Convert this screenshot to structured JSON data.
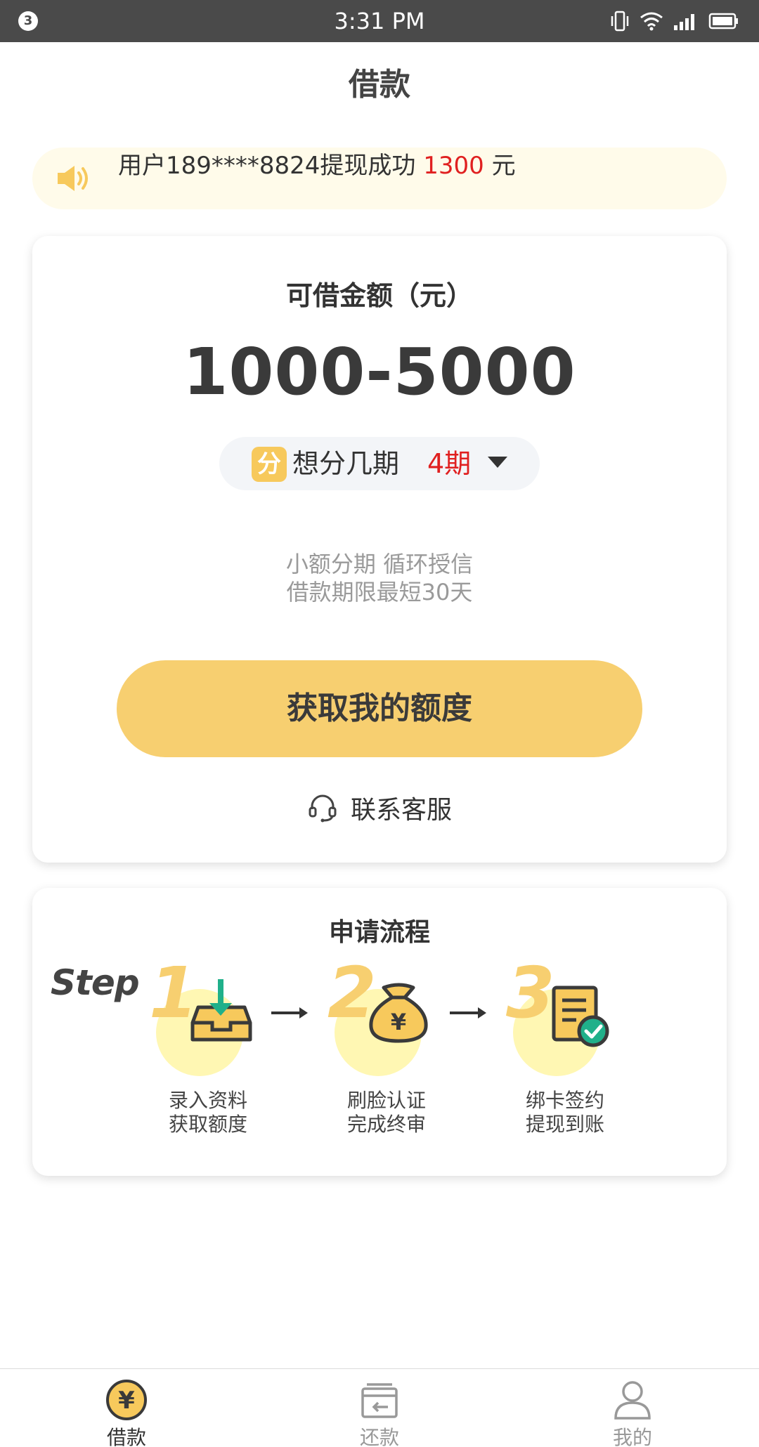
{
  "status_bar": {
    "notification_count": "3",
    "time": "3:31 PM"
  },
  "header": {
    "title": "借款"
  },
  "notice": {
    "prefix": "用户189****8824提现成功 ",
    "amount": "1300",
    "suffix": " 元"
  },
  "loan_card": {
    "label": "可借金额（元）",
    "amount_range": "1000-5000",
    "installment_badge": "分",
    "installment_prompt": "想分几期",
    "installment_value": "4期",
    "desc_line1": "小额分期 循环授信",
    "desc_line2": "借款期限最短30天",
    "cta_label": "获取我的额度",
    "support_label": "联系客服"
  },
  "process": {
    "title": "申请流程",
    "step_word": "Step",
    "steps": [
      {
        "num": "1",
        "line1": "录入资料",
        "line2": "获取额度",
        "icon": "inbox-download-icon"
      },
      {
        "num": "2",
        "line1": "刷脸认证",
        "line2": "完成终审",
        "icon": "money-bag-icon"
      },
      {
        "num": "3",
        "line1": "绑卡签约",
        "line2": "提现到账",
        "icon": "document-check-icon"
      }
    ]
  },
  "tabbar": {
    "tabs": [
      {
        "label": "借款",
        "icon": "yuan-coin-icon",
        "active": true
      },
      {
        "label": "还款",
        "icon": "repay-card-icon",
        "active": false
      },
      {
        "label": "我的",
        "icon": "user-icon",
        "active": false
      }
    ]
  },
  "colors": {
    "accent": "#f7cf70",
    "highlight_red": "#e02020",
    "status_bar": "#4a4a4a"
  }
}
